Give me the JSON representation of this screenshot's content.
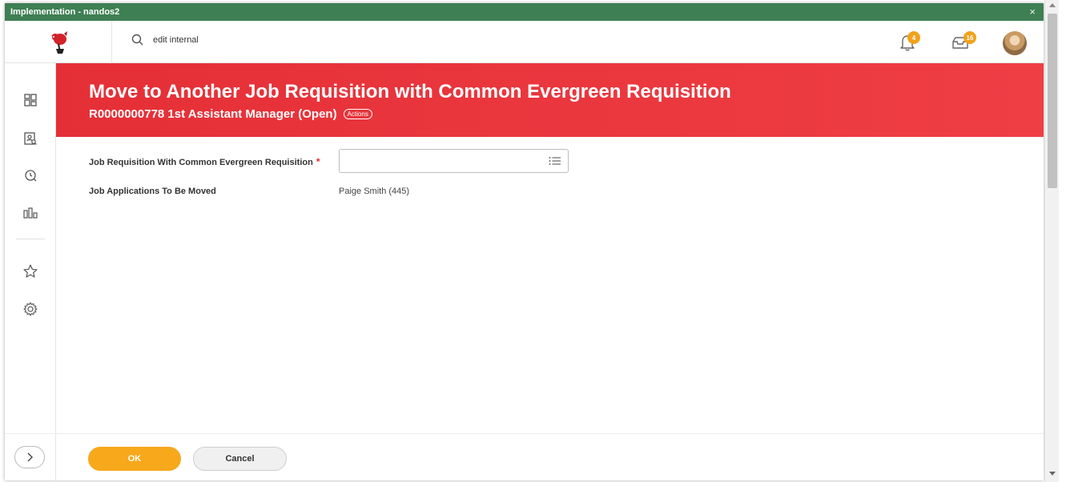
{
  "window": {
    "title": "Implementation - nandos2",
    "close_glyph": "×"
  },
  "topbar": {
    "logo_icon": "nandos-rooster-logo",
    "search_icon": "search-icon",
    "search_value": "edit internal",
    "notifications": {
      "icon": "bell-icon",
      "count": "4"
    },
    "inbox": {
      "icon": "inbox-icon",
      "count": "16"
    },
    "avatar_icon": "user-avatar"
  },
  "sidebar": {
    "items": [
      {
        "icon": "apps-grid-icon"
      },
      {
        "icon": "profile-search-icon"
      },
      {
        "icon": "recent-icon"
      },
      {
        "icon": "dashboards-icon"
      },
      {
        "icon": "favorites-star-icon"
      },
      {
        "icon": "settings-gear-icon"
      }
    ],
    "expand_icon": "chevron-right-icon"
  },
  "banner": {
    "title": "Move to Another Job Requisition with Common Evergreen Requisition",
    "subtitle": "R0000000778 1st Assistant Manager (Open)",
    "actions_label": "Actions"
  },
  "form": {
    "field1": {
      "label": "Job Requisition With Common Evergreen Requisition",
      "required_mark": "*",
      "value": "",
      "prompt_icon": "list-prompt-icon"
    },
    "field2": {
      "label": "Job Applications To Be Moved",
      "value": "Paige Smith (445)"
    }
  },
  "footer": {
    "ok_label": "OK",
    "cancel_label": "Cancel"
  },
  "colors": {
    "titlebar": "#3e7f53",
    "banner": "#e52f37",
    "primary_button": "#f7a81b",
    "badge": "#f2a11a",
    "required": "#e12a2a"
  }
}
